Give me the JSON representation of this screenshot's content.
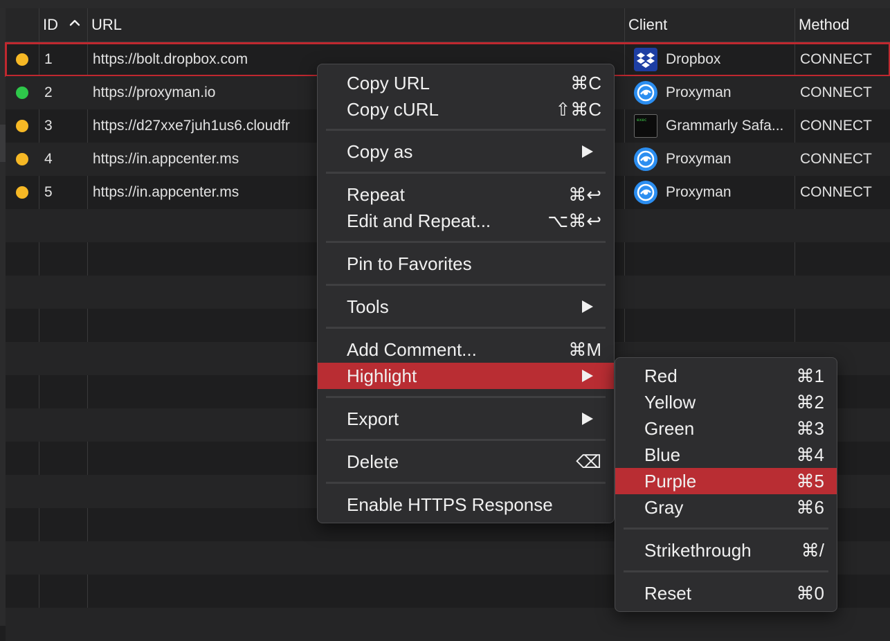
{
  "table": {
    "columns": {
      "id": "ID",
      "url": "URL",
      "client": "Client",
      "method": "Method"
    },
    "rows": [
      {
        "id": "1",
        "url": "https://bolt.dropbox.com",
        "client": "Dropbox",
        "method": "CONNECT",
        "status_color": "#f6b825",
        "icon": "dropbox-icon"
      },
      {
        "id": "2",
        "url": "https://proxyman.io",
        "client": "Proxyman",
        "method": "CONNECT",
        "status_color": "#2ec84a",
        "icon": "proxyman-icon"
      },
      {
        "id": "3",
        "url": "https://d27xxe7juh1us6.cloudfr",
        "client": "Grammarly Safa...",
        "method": "CONNECT",
        "status_color": "#f6b825",
        "icon": "terminal-icon"
      },
      {
        "id": "4",
        "url": "https://in.appcenter.ms",
        "client": "Proxyman",
        "method": "CONNECT",
        "status_color": "#f6b825",
        "icon": "proxyman-icon"
      },
      {
        "id": "5",
        "url": "https://in.appcenter.ms",
        "client": "Proxyman",
        "method": "CONNECT",
        "status_color": "#f6b825",
        "icon": "proxyman-icon"
      }
    ],
    "terminal_icon_text": "exec"
  },
  "context_menu": {
    "copy_url": {
      "label": "Copy URL",
      "shortcut": "⌘C"
    },
    "copy_curl": {
      "label": "Copy cURL",
      "shortcut": "⇧⌘C"
    },
    "copy_as": {
      "label": "Copy as"
    },
    "repeat": {
      "label": "Repeat",
      "shortcut": "⌘↩"
    },
    "edit_repeat": {
      "label": "Edit and Repeat...",
      "shortcut": "⌥⌘↩"
    },
    "pin": {
      "label": "Pin to Favorites"
    },
    "tools": {
      "label": "Tools"
    },
    "add_comment": {
      "label": "Add Comment...",
      "shortcut": "⌘M"
    },
    "highlight": {
      "label": "Highlight"
    },
    "export": {
      "label": "Export"
    },
    "delete": {
      "label": "Delete",
      "shortcut": "⌫"
    },
    "enable_https": {
      "label": "Enable HTTPS Response"
    }
  },
  "highlight_submenu": {
    "red": {
      "label": "Red",
      "shortcut": "⌘1"
    },
    "yellow": {
      "label": "Yellow",
      "shortcut": "⌘2"
    },
    "green": {
      "label": "Green",
      "shortcut": "⌘3"
    },
    "blue": {
      "label": "Blue",
      "shortcut": "⌘4"
    },
    "purple": {
      "label": "Purple",
      "shortcut": "⌘5"
    },
    "gray": {
      "label": "Gray",
      "shortcut": "⌘6"
    },
    "strikethrough": {
      "label": "Strikethrough",
      "shortcut": "⌘/"
    },
    "reset": {
      "label": "Reset",
      "shortcut": "⌘0"
    }
  },
  "colors": {
    "highlight": "#b92d33",
    "selection_outline": "#c0282f",
    "background": "#1e1e1f"
  }
}
